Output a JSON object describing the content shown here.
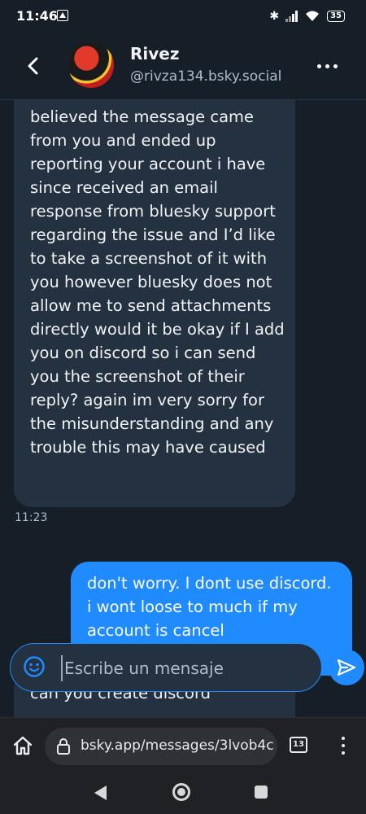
{
  "status_bar": {
    "time": "11:46",
    "battery": "35"
  },
  "header": {
    "contact_name": "Rivez",
    "contact_handle": "@rivza134.bsky.social",
    "back_icon": "chevron-left-icon",
    "more_icon": "more-horizontal-icon"
  },
  "messages": [
    {
      "direction": "incoming",
      "text": "believed the message came from you and ended up reporting your account i have since received an email response from bluesky support regarding the issue and I’d like to take a screenshot of it with you however bluesky does not allow me to send attachments directly would it be okay if I add you on discord so i can send you the screenshot of their reply? again im very sorry for the misunderstanding and any trouble this may have caused",
      "time": "11:23"
    },
    {
      "direction": "outgoing",
      "text": "don't worry. I dont use discord. i wont loose to much if my account is cancel"
    },
    {
      "direction": "incoming",
      "text": "can you create discord"
    }
  ],
  "composer": {
    "placeholder": "Escribe un mensaje",
    "emoji_icon": "emoji-smile-icon",
    "send_icon": "send-icon"
  },
  "browser": {
    "url": "bsky.app/messages/3lvob4c",
    "tab_count": "13"
  },
  "colors": {
    "background": "#161e27",
    "incoming_bubble": "#243140",
    "outgoing_bubble": "#208bfe",
    "accent": "#208bfe"
  }
}
